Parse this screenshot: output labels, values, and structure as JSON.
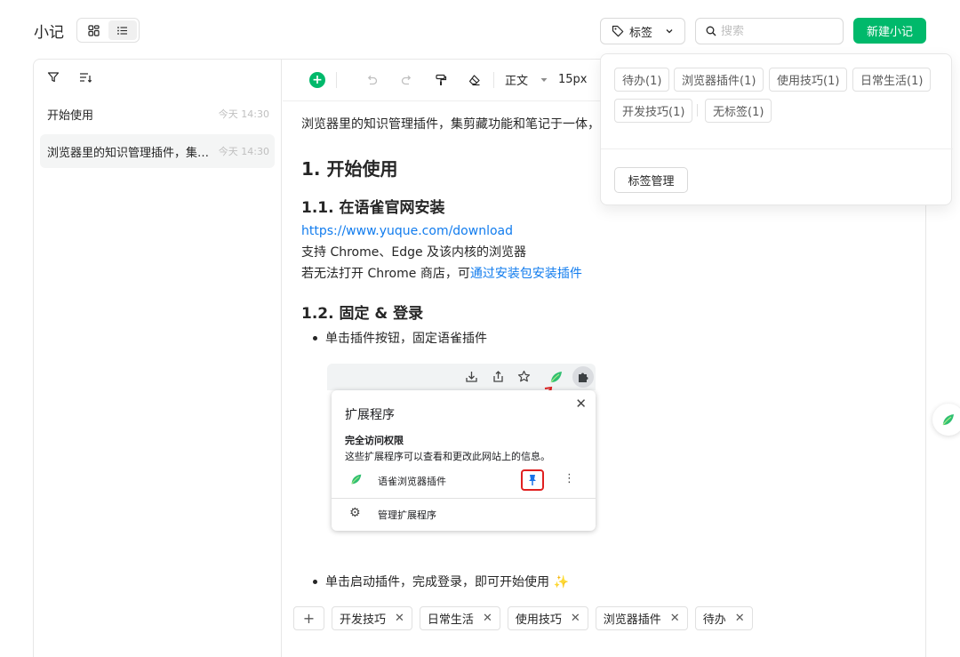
{
  "header": {
    "title": "小记",
    "tag_filter_label": "标签",
    "search_placeholder": "搜索",
    "new_note_label": "新建小记"
  },
  "sidebar": {
    "notes": [
      {
        "title": "开始使用",
        "time": "今天 14:30"
      },
      {
        "title": "浏览器里的知识管理插件，集剪藏功能和笔记于一体，",
        "time": "今天 14:30"
      }
    ]
  },
  "toolbar": {
    "paragraph_style": "正文",
    "font_size": "15px"
  },
  "document": {
    "intro": "浏览器里的知识管理插件，集剪藏功能和笔记于一体，",
    "h1": "1. 开始使用",
    "h2_install": "1.1. 在语雀官网安装",
    "install_link": "https://www.yuque.com/download",
    "support_text": "支持 Chrome、Edge 及该内核的浏览器",
    "store_text_prefix": "若无法打开 Chrome 商店，可",
    "store_link": "通过安装包安装插件",
    "h2_pin": "1.2. 固定 & 登录",
    "bullet_pin": "单击插件按钮，固定语雀插件",
    "bullet_login": "单击启动插件，完成登录，即可开始使用 ✨"
  },
  "embedded_screenshot": {
    "panel_title": "扩展程序",
    "access_title": "完全访问权限",
    "access_desc": "这些扩展程序可以查看和更改此网站上的信息。",
    "extension_name": "语雀浏览器插件",
    "manage_label": "管理扩展程序"
  },
  "note_tags": [
    "开发技巧",
    "日常生活",
    "使用技巧",
    "浏览器插件",
    "待办"
  ],
  "tag_dropdown": {
    "tags": [
      "待办(1)",
      "浏览器插件(1)",
      "使用技巧(1)",
      "日常生活(1)",
      "开发技巧(1)"
    ],
    "untagged": "无标签(1)",
    "manage_label": "标签管理"
  },
  "colors": {
    "accent": "#00b96b",
    "link": "#117cee",
    "highlight_red": "#e02020"
  }
}
